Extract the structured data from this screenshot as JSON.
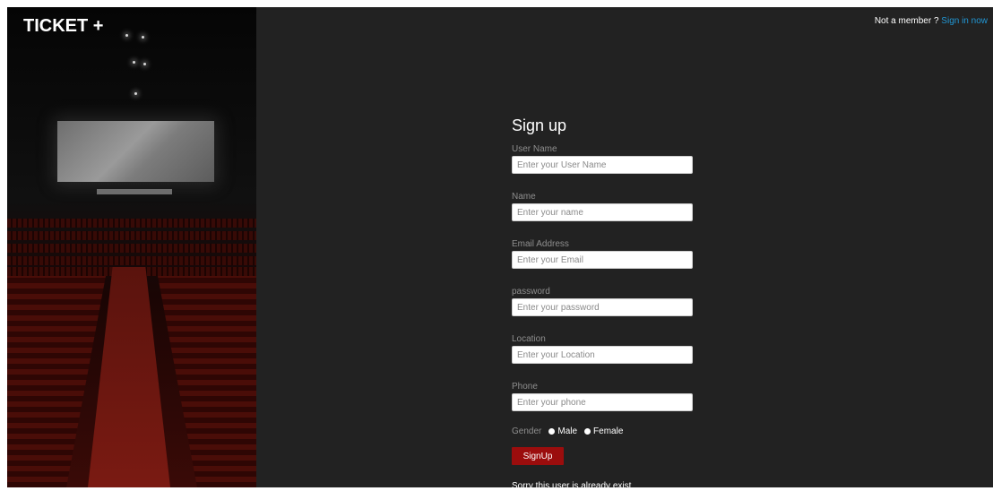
{
  "brand": {
    "title": "TICKET +"
  },
  "header": {
    "not_member_text": "Not a member ?",
    "sign_in_link": "Sign in now"
  },
  "form": {
    "title": "Sign up",
    "fields": [
      {
        "label": "User Name",
        "placeholder": "Enter your User Name"
      },
      {
        "label": "Name",
        "placeholder": "Enter your name"
      },
      {
        "label": "Email Address",
        "placeholder": "Enter your Email"
      },
      {
        "label": "password",
        "placeholder": "Enter your password"
      },
      {
        "label": "Location",
        "placeholder": "Enter your Location"
      },
      {
        "label": "Phone",
        "placeholder": "Enter your phone"
      }
    ],
    "gender": {
      "label": "Gender",
      "options": [
        "Male",
        "Female"
      ]
    },
    "submit_label": "SignUp",
    "error_message": "Sorry this user is already exist"
  },
  "colors": {
    "panel_bg": "#222222",
    "button_bg": "#9b0d0d",
    "link": "#2196d3",
    "label": "#8e8e8e"
  }
}
